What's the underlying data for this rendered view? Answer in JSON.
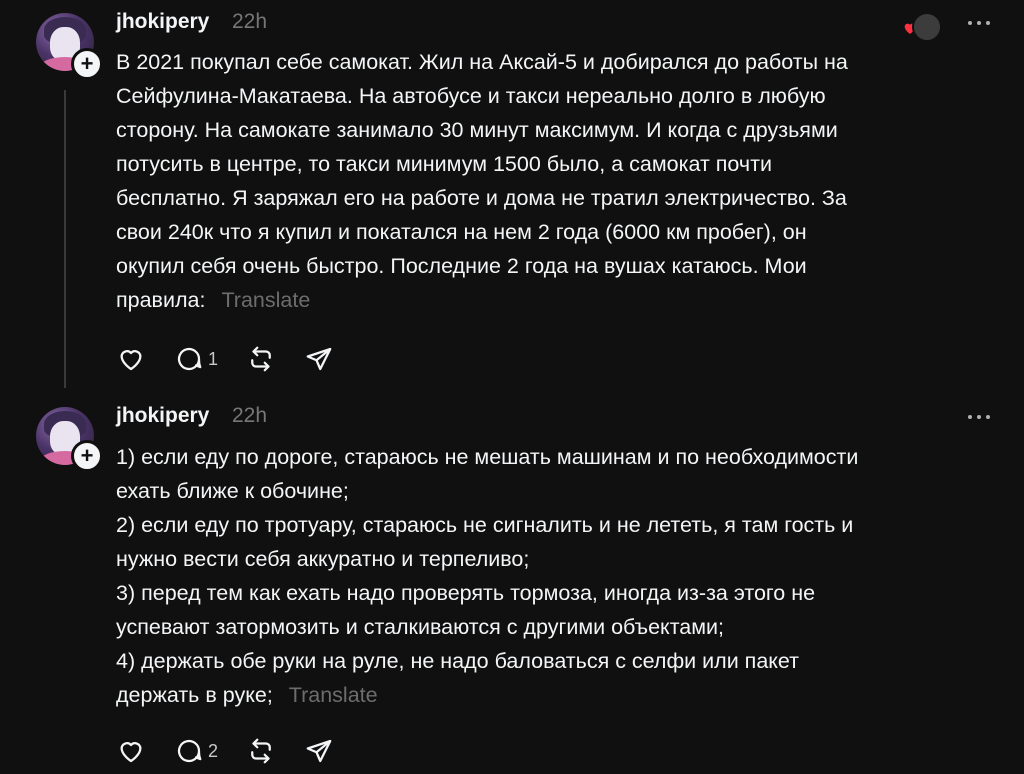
{
  "posts": [
    {
      "username": "jhokipery",
      "time": "22h",
      "body": "В 2021 покупал себе самокат. Жил на Аксай-5 и добирался до работы на\nСейфулина-Макатаева. На автобусе и такси нереально долго в любую\nсторону. На самокате занимало 30 минут максимум. И когда с друзьями\nпотусить в центре, то такси минимум 1500 было, а самокат почти\nбесплатно. Я заряжал его на работе и дома не тратил электричество. За\nсвои 240к что я купил и покатался на нем 2 года (6000 км пробег), он\nокупил себя очень быстро. Последние 2 года на вушах катаюсь. Мои\nправила: ",
      "translate_label": "Translate",
      "reply_count": "1",
      "icons": [
        "heart-icon",
        "reply-icon",
        "repost-icon",
        "share-icon",
        "more-icon",
        "follow-plus-icon"
      ]
    },
    {
      "username": "jhokipery",
      "time": "22h",
      "body": "1) если еду по дороге, стараюсь не мешать машинам и по необходимости\nехать ближе к обочине;\n2) если еду по тротуару, стараюсь не сигналить и не лететь, я там гость и\nнужно вести себя аккуратно и терпеливо;\n3) перед тем как ехать надо проверять тормоза, иногда из-за этого не\nуспевают затормозить и сталкиваются с другими объектами;\n4) держать обе руки на руле, не надо баловаться с селфи или пакет\nдержать в руке; ",
      "translate_label": "Translate",
      "reply_count": "2",
      "icons": [
        "heart-icon",
        "reply-icon",
        "repost-icon",
        "share-icon",
        "more-icon",
        "follow-plus-icon"
      ]
    }
  ],
  "colors": {
    "background": "#101010",
    "text": "#f3f5f7",
    "muted": "#777777",
    "like_heart": "#ff3040"
  }
}
